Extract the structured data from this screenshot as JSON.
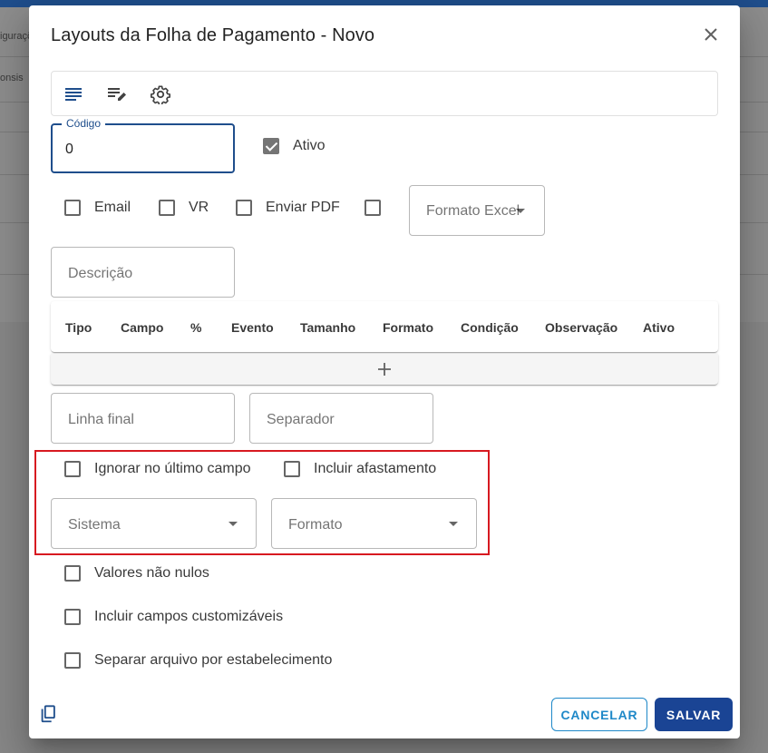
{
  "background": {
    "row1_text": "iguraçõ",
    "row2_text": "onsis"
  },
  "dialog": {
    "title": "Layouts da Folha de Pagamento - Novo",
    "close_icon": "close-icon"
  },
  "toolbar": {
    "icons": [
      "list-icon",
      "edit-list-icon",
      "gear-icon"
    ]
  },
  "form": {
    "codigo": {
      "label": "Código",
      "value": "0"
    },
    "ativo": {
      "label": "Ativo",
      "checked": true
    },
    "email": {
      "label": "Email",
      "checked": false
    },
    "vr": {
      "label": "VR",
      "checked": false
    },
    "enviar_pdf": {
      "label": "Enviar PDF",
      "checked": false
    },
    "excel_checkbox": {
      "checked": false
    },
    "formato_excel": {
      "placeholder": "Formato Excel"
    },
    "descricao": {
      "placeholder": "Descrição"
    },
    "linha_final": {
      "placeholder": "Linha final"
    },
    "separador": {
      "placeholder": "Separador"
    },
    "ignorar_ultimo_campo": {
      "label": "Ignorar no último campo",
      "checked": false
    },
    "incluir_afastamento": {
      "label": "Incluir afastamento",
      "checked": false
    },
    "sistema": {
      "placeholder": "Sistema"
    },
    "formato": {
      "placeholder": "Formato"
    },
    "valores_nao_nulos": {
      "label": "Valores não nulos",
      "checked": false
    },
    "incluir_campos_customizaveis": {
      "label": "Incluir campos customizáveis",
      "checked": false
    },
    "separar_arquivo": {
      "label": "Separar arquivo por estabelecimento",
      "checked": false
    }
  },
  "table": {
    "columns": [
      "Tipo",
      "Campo",
      "%",
      "Evento",
      "Tamanho",
      "Formato",
      "Condição",
      "Observação",
      "Ativo"
    ],
    "add_icon": "plus-icon"
  },
  "actions": {
    "cancel_label": "CANCELAR",
    "save_label": "SALVAR",
    "copy_icon": "copy-icon"
  },
  "colors": {
    "primary": "#1a4494",
    "focus": "#1f4e8c",
    "cancel": "#1e88c8",
    "highlight": "#d71920"
  }
}
